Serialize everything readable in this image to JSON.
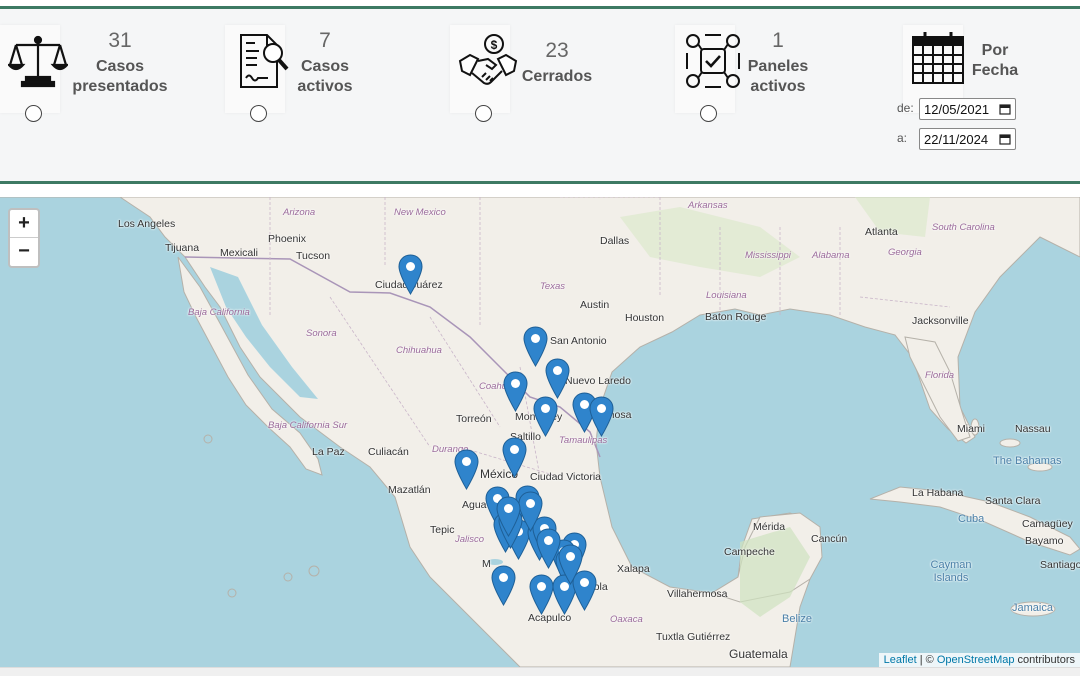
{
  "stats": [
    {
      "id": "presentados",
      "count": "31",
      "label_1": "Casos",
      "label_2": "presentados",
      "icon": "scale-icon"
    },
    {
      "id": "activos",
      "count": "7",
      "label_1": "Casos",
      "label_2": "activos",
      "icon": "document-search-icon"
    },
    {
      "id": "cerrados",
      "count": "23",
      "label_1": "Cerrados",
      "label_2": "",
      "icon": "handshake-icon"
    },
    {
      "id": "paneles",
      "count": "1",
      "label_1": "Paneles",
      "label_2": "activos",
      "icon": "panel-network-icon"
    }
  ],
  "date_filter": {
    "label_1": "Por",
    "label_2": "Fecha",
    "from_label": "de:",
    "from_value": "12/05/2021",
    "to_label": "a:",
    "to_value": "22/11/2024",
    "icon": "calendar-icon"
  },
  "map": {
    "zoom_in": "+",
    "zoom_out": "−",
    "attribution_leaflet": "Leaflet",
    "attribution_sep": " | © ",
    "attribution_osm": "OpenStreetMap",
    "attribution_rest": " contributors",
    "marker_color": "#2f84cc",
    "places": {
      "los_angeles": "Los Angeles",
      "arizona": "Arizona",
      "new_mexico": "New Mexico",
      "tijuana": "Tijuana",
      "mexicali": "Mexicali",
      "phoenix": "Phoenix",
      "tucson": "Tucson",
      "ciudad_juarez": "Ciudad Juárez",
      "dallas": "Dallas",
      "atlanta": "Atlanta",
      "south_carolina": "South Carolina",
      "georgia": "Georgia",
      "mississippi": "Mississippi",
      "alabama": "Alabama",
      "louisiana": "Louisiana",
      "arkansas": "Arkansas",
      "texas": "Texas",
      "austin": "Austin",
      "houston": "Houston",
      "baton_rouge": "Baton Rouge",
      "jacksonville": "Jacksonville",
      "san_antonio": "San Antonio",
      "baja_california": "Baja California",
      "sonora": "Sonora",
      "chihuahua": "Chihuahua",
      "coahuila": "Coahuila",
      "nuevo_laredo": "Nuevo Laredo",
      "florida": "Florida",
      "torreon": "Torreón",
      "monterrey": "Monterrey",
      "reynosa": "Reynosa",
      "saltillo": "Saltillo",
      "tamaulipas": "Tamaulipas",
      "miami": "Miami",
      "nassau": "Nassau",
      "baja_california_sur": "Baja California Sur",
      "la_paz": "La Paz",
      "culiacan": "Culiacán",
      "durango": "Durango",
      "mexico": "México",
      "ciudad_victoria": "Ciudad Victoria",
      "the_bahamas": "The Bahamas",
      "la_habana": "La Habana",
      "santa_clara": "Santa Clara",
      "mazatlan": "Mazatlán",
      "aguascalientes": "Agua",
      "cuba": "Cuba",
      "camaguey": "Camagüey",
      "merida": "Mérida",
      "cancun": "Cancún",
      "bayamo": "Bayamo",
      "tepic": "Tepic",
      "jalisco": "Jalisco",
      "campeche": "Campeche",
      "santiago_de_cuba": "Santiago de Cuba",
      "xalapa": "Xalapa",
      "cayman_islands": "Cayman Islands",
      "morelia": "M",
      "puebla": "Puebla",
      "villahermosa": "Villahermosa",
      "jamaica": "Jamaica",
      "acapulco": "Acapulco",
      "oaxaca": "Oaxaca",
      "belize": "Belize",
      "tuxtla": "Tuxtla Gutiérrez",
      "guatemala": "Guatemala"
    },
    "markers_count": 28
  }
}
